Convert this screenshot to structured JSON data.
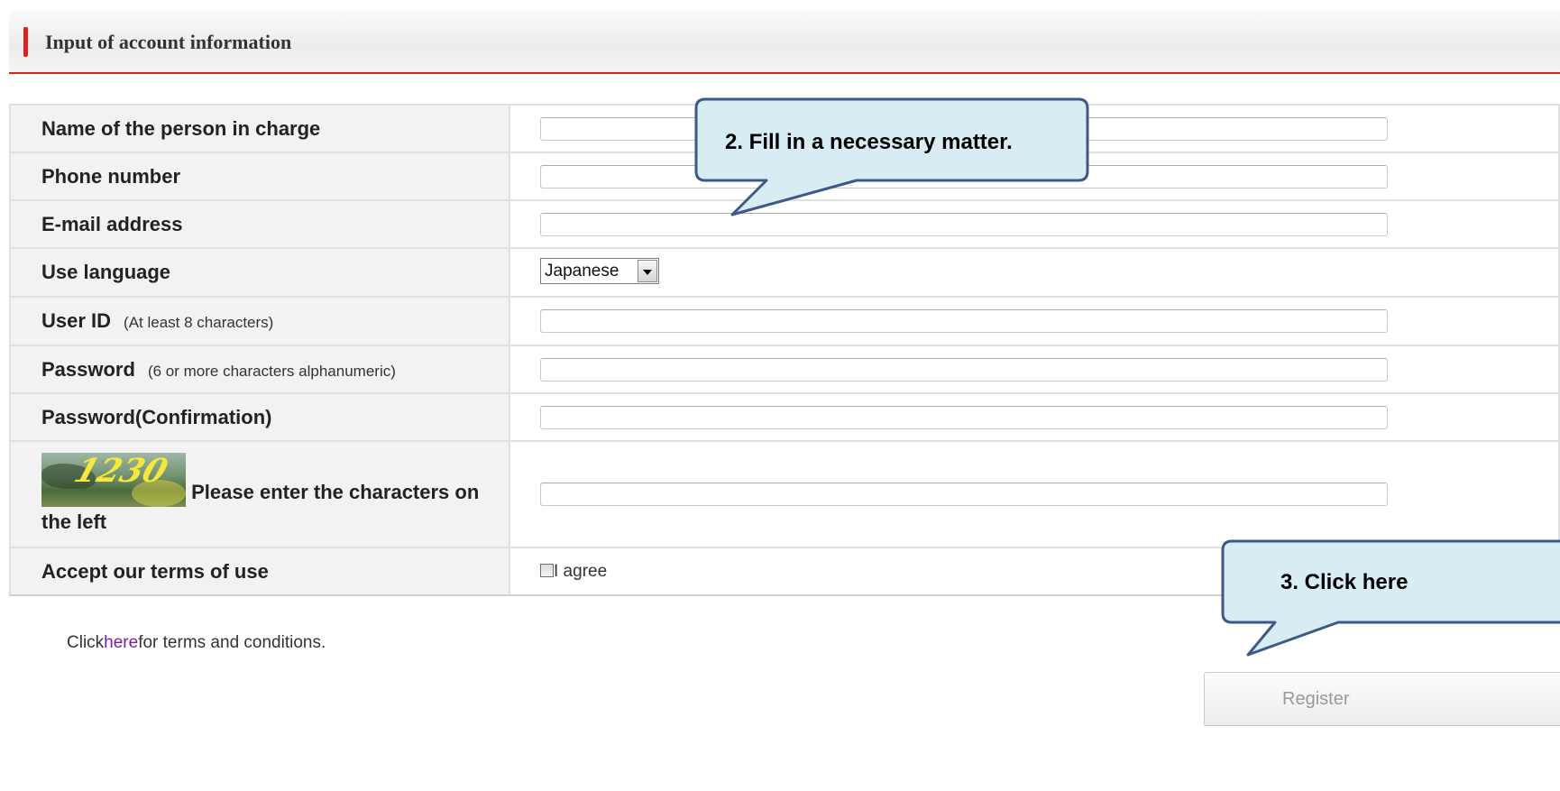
{
  "section": {
    "title": "Input of account information"
  },
  "form": {
    "rows": [
      {
        "label": "Name of the person in charge",
        "note": ""
      },
      {
        "label": "Phone number",
        "note": ""
      },
      {
        "label": "E-mail address",
        "note": ""
      },
      {
        "label": "Use language",
        "note": ""
      },
      {
        "label": "User ID",
        "note": "(At least 8 characters)"
      },
      {
        "label": "Password",
        "note": "(6 or more characters alphanumeric)"
      },
      {
        "label": "Password(Confirmation)",
        "note": ""
      },
      {
        "label": "Please enter the characters on the left",
        "note": ""
      },
      {
        "label": "Accept our terms of use",
        "note": ""
      }
    ],
    "language_select": {
      "selected": "Japanese"
    },
    "captcha": {
      "text": "1230"
    },
    "agree_label": "I agree"
  },
  "terms": {
    "prefix": "Click",
    "link": "here",
    "suffix": "for terms and conditions."
  },
  "register_label": "Register",
  "callouts": {
    "fill": "2.  Fill in a necessary matter.",
    "click": "3.  Click here"
  },
  "colors": {
    "accent": "#e0201f",
    "callout_fill": "#d8ecf3",
    "callout_border": "#3c5a86",
    "link": "#7c1d9e"
  }
}
